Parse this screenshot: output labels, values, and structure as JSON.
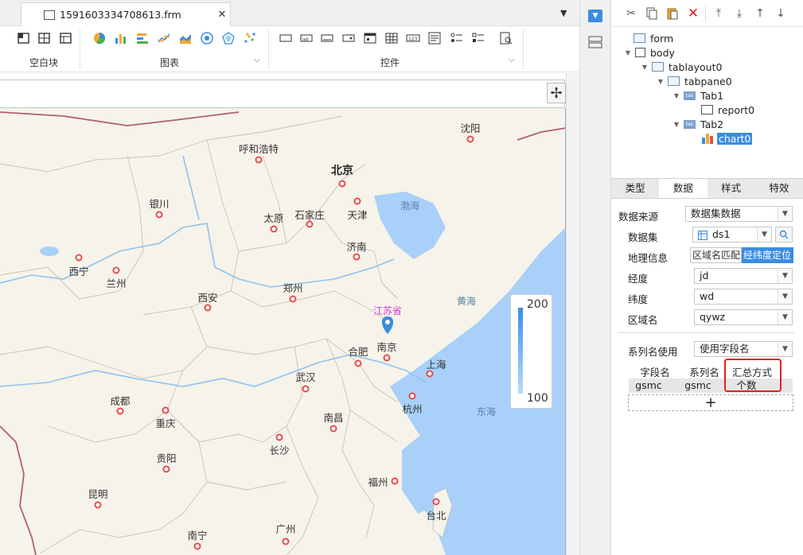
{
  "file_tab": {
    "title": "1591603334708613.frm",
    "close": "✕"
  },
  "ribbon": {
    "groups": [
      {
        "label": "空白块"
      },
      {
        "label": "图表"
      },
      {
        "label": "控件"
      }
    ]
  },
  "map": {
    "province_label": "江苏省",
    "cities": [
      {
        "name": "沈阳"
      },
      {
        "name": "呼和浩特"
      },
      {
        "name": "北京"
      },
      {
        "name": "天津"
      },
      {
        "name": "银川"
      },
      {
        "name": "太原"
      },
      {
        "name": "石家庄"
      },
      {
        "name": "济南"
      },
      {
        "name": "西宁"
      },
      {
        "name": "兰州"
      },
      {
        "name": "郑州"
      },
      {
        "name": "西安"
      },
      {
        "name": "合肥"
      },
      {
        "name": "南京"
      },
      {
        "name": "上海"
      },
      {
        "name": "武汉"
      },
      {
        "name": "成都"
      },
      {
        "name": "重庆"
      },
      {
        "name": "杭州"
      },
      {
        "name": "南昌"
      },
      {
        "name": "长沙"
      },
      {
        "name": "贵阳"
      },
      {
        "name": "福州"
      },
      {
        "name": "昆明"
      },
      {
        "name": "台北"
      },
      {
        "name": "南宁"
      },
      {
        "name": "广州"
      }
    ],
    "seas": [
      {
        "name": "渤海"
      },
      {
        "name": "黄海"
      },
      {
        "name": "东海"
      }
    ],
    "legend": {
      "max": "200",
      "min": "100"
    }
  },
  "tree": {
    "nodes": [
      {
        "label": "form"
      },
      {
        "label": "body"
      },
      {
        "label": "tablayout0"
      },
      {
        "label": "tabpane0"
      },
      {
        "label": "Tab1"
      },
      {
        "label": "report0"
      },
      {
        "label": "Tab2"
      },
      {
        "label": "chart0"
      }
    ],
    "tab_icon_text": "tab"
  },
  "prop_tabs": [
    {
      "label": "类型"
    },
    {
      "label": "数据"
    },
    {
      "label": "样式"
    },
    {
      "label": "特效"
    }
  ],
  "props": {
    "data_source": {
      "label": "数据来源",
      "value": "数据集数据"
    },
    "dataset": {
      "label": "数据集",
      "value": "ds1"
    },
    "geo_info": {
      "label": "地理信息",
      "opt1": "区域名匹配",
      "opt2": "经纬度定位"
    },
    "longitude": {
      "label": "经度",
      "value": "jd"
    },
    "latitude": {
      "label": "纬度",
      "value": "wd"
    },
    "region": {
      "label": "区域名",
      "value": "qywz"
    },
    "series_name": {
      "label": "系列名使用",
      "value": "使用字段名"
    }
  },
  "table": {
    "headers": [
      "字段名",
      "系列名",
      "汇总方式"
    ],
    "rows": [
      [
        "gsmc",
        "gsmc",
        "个数"
      ]
    ],
    "add": "+"
  },
  "colors": {
    "accent": "#3b8de0",
    "highlight": "#e02020",
    "marker": "#3b8de0",
    "province": "#d63ad6"
  }
}
